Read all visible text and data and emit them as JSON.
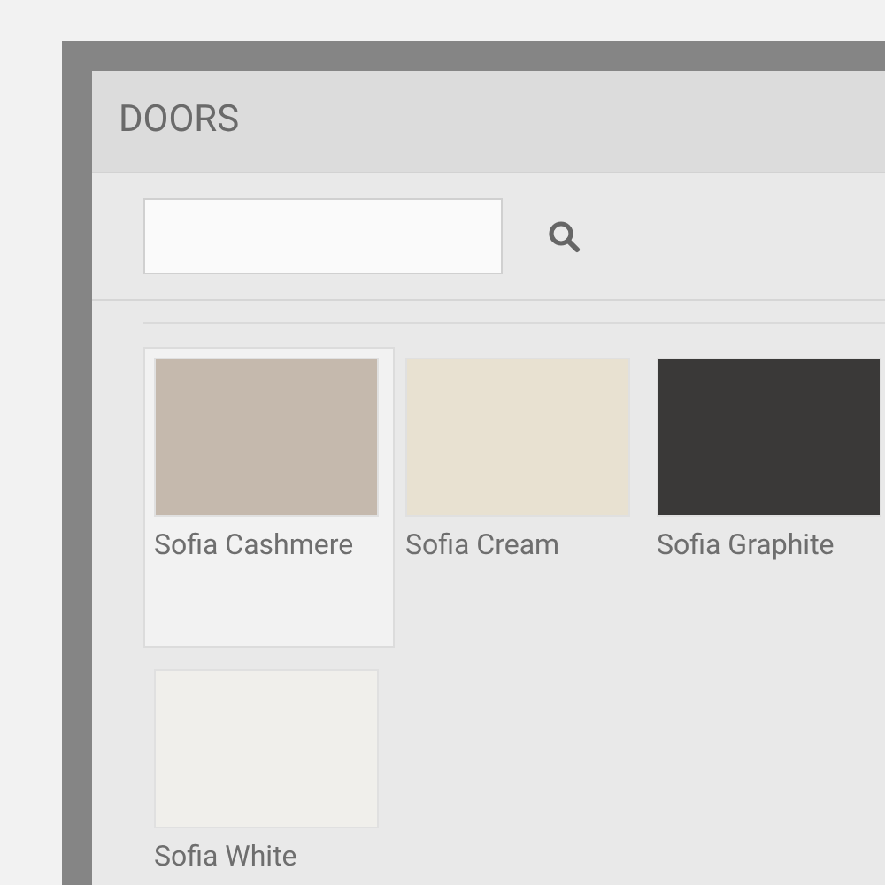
{
  "dialog": {
    "title": "DOORS"
  },
  "doors": [
    {
      "name": "Sofia Cashmere",
      "color": "#c5b9ad",
      "selected": true
    },
    {
      "name": "Sofia Cream",
      "color": "#e8e1d1",
      "selected": false
    },
    {
      "name": "Sofia Graphite",
      "color": "#3a3938",
      "selected": false
    },
    {
      "name": "Sofia White",
      "color": "#f0efeb",
      "selected": false
    }
  ]
}
